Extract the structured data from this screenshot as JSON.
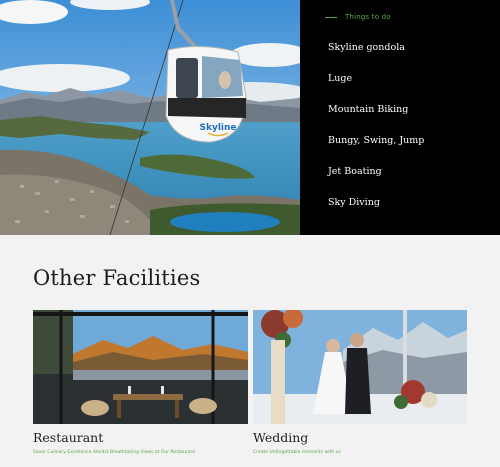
{
  "hero": {
    "panel_heading": "Things to do",
    "activities": [
      "Skyline gondola",
      "Luge",
      "Mountain Biking",
      "Bungy, Swing, Jump",
      "Jet Boating",
      "Sky Diving"
    ],
    "gondola_logo_text": "Skyline"
  },
  "facilities": {
    "title": "Other Facilities",
    "cards": [
      {
        "title": "Restaurant",
        "description": "Savor Culinary Excellence Amidst Breathtaking Views at Our Restaurant"
      },
      {
        "title": "Wedding",
        "description": "Create Unforgettable moments with us"
      }
    ]
  },
  "colors": {
    "accent": "#5aa64a",
    "panel_bg": "#000000",
    "page_bg": "#f2f2f2"
  }
}
